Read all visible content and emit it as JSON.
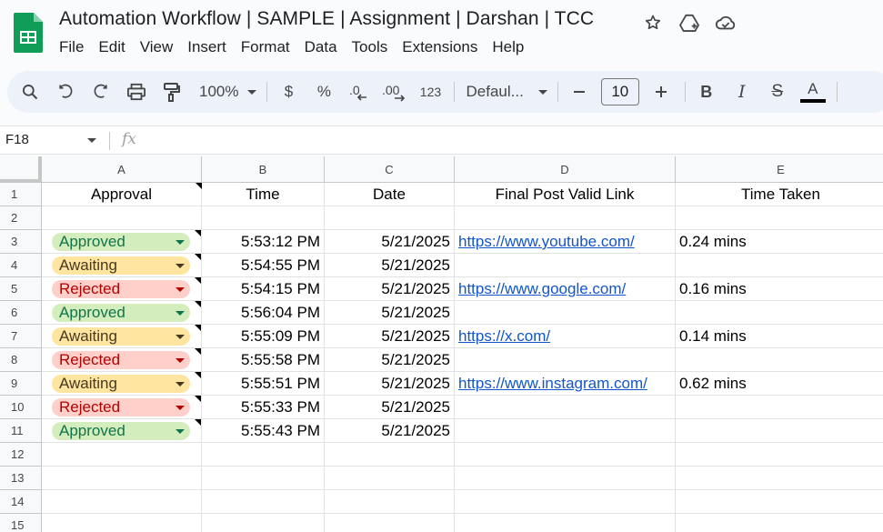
{
  "document": {
    "title": "Automation Workflow | SAMPLE | Assignment | Darshan | TCC"
  },
  "menu": [
    "File",
    "Edit",
    "View",
    "Insert",
    "Format",
    "Data",
    "Tools",
    "Extensions",
    "Help"
  ],
  "toolbar": {
    "zoom": "100%",
    "currency_label": "$",
    "percent_label": "%",
    "format_more_label": "123",
    "font_name": "Defaul...",
    "font_size": "10",
    "bold_label": "B",
    "italic_label": "I",
    "strike_label": "S",
    "text_color_label": "A"
  },
  "formula_bar": {
    "cell_ref": "F18",
    "fx_label": "fx"
  },
  "columns": [
    "A",
    "B",
    "C",
    "D",
    "E"
  ],
  "header_row": {
    "num": "1",
    "approval": "Approval",
    "time": "Time",
    "date": "Date",
    "link": "Final Post Valid Link",
    "time_taken": "Time Taken"
  },
  "rows": [
    {
      "num": "2",
      "approval": "",
      "time": "",
      "date": "",
      "link": "",
      "time_taken": ""
    },
    {
      "num": "3",
      "approval": "Approved",
      "time": "5:53:12 PM",
      "date": "5/21/2025",
      "link": "https://www.youtube.com/",
      "time_taken": "0.24 mins"
    },
    {
      "num": "4",
      "approval": "Awaiting",
      "time": "5:54:55 PM",
      "date": "5/21/2025",
      "link": "",
      "time_taken": ""
    },
    {
      "num": "5",
      "approval": "Rejected",
      "time": "5:54:15 PM",
      "date": "5/21/2025",
      "link": "https://www.google.com/",
      "time_taken": "0.16 mins"
    },
    {
      "num": "6",
      "approval": "Approved",
      "time": "5:56:04 PM",
      "date": "5/21/2025",
      "link": "",
      "time_taken": ""
    },
    {
      "num": "7",
      "approval": "Awaiting",
      "time": "5:55:09 PM",
      "date": "5/21/2025",
      "link": "https://x.com/",
      "time_taken": "0.14 mins"
    },
    {
      "num": "8",
      "approval": "Rejected",
      "time": "5:55:58 PM",
      "date": "5/21/2025",
      "link": "",
      "time_taken": ""
    },
    {
      "num": "9",
      "approval": "Awaiting",
      "time": "5:55:51 PM",
      "date": "5/21/2025",
      "link": "https://www.instagram.com/",
      "time_taken": "0.62 mins"
    },
    {
      "num": "10",
      "approval": "Rejected",
      "time": "5:55:33 PM",
      "date": "5/21/2025",
      "link": "",
      "time_taken": ""
    },
    {
      "num": "11",
      "approval": "Approved",
      "time": "5:55:43 PM",
      "date": "5/21/2025",
      "link": "",
      "time_taken": ""
    },
    {
      "num": "12",
      "approval": "",
      "time": "",
      "date": "",
      "link": "",
      "time_taken": ""
    },
    {
      "num": "13",
      "approval": "",
      "time": "",
      "date": "",
      "link": "",
      "time_taken": ""
    },
    {
      "num": "14",
      "approval": "",
      "time": "",
      "date": "",
      "link": "",
      "time_taken": ""
    },
    {
      "num": "15",
      "approval": "",
      "time": "",
      "date": "",
      "link": "",
      "time_taken": ""
    }
  ],
  "status_colors": {
    "Approved": {
      "bg": "#d4edbc",
      "fg": "#11734b",
      "caret": "#11734b"
    },
    "Awaiting": {
      "bg": "#ffe5a0",
      "fg": "#473821",
      "caret": "#473821"
    },
    "Rejected": {
      "bg": "#ffcfc9",
      "fg": "#b10202",
      "caret": "#b10202"
    }
  },
  "icons": {
    "logo": "google-sheets-logo",
    "star": "star-icon",
    "move": "move-to-drive-icon",
    "cloud": "cloud-saved-icon"
  }
}
